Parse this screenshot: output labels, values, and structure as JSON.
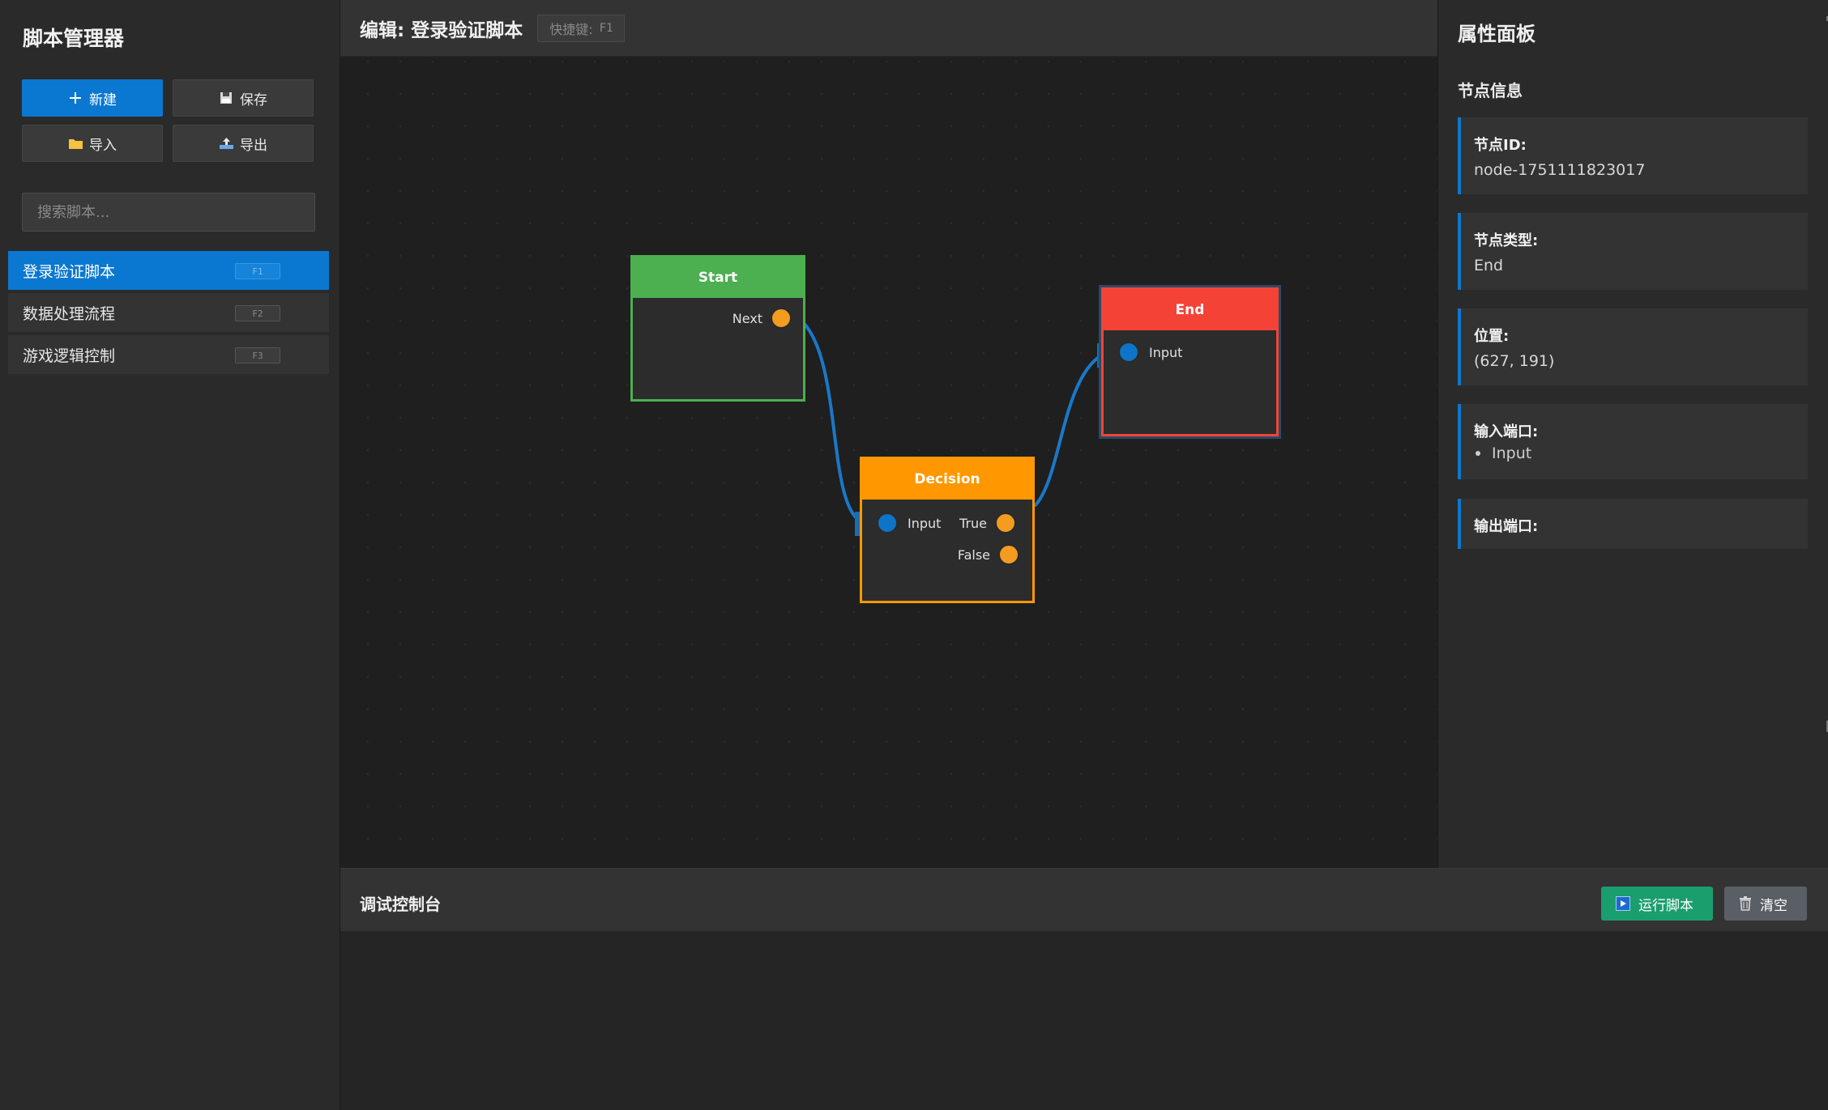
{
  "sidebar": {
    "title": "脚本管理器",
    "buttons": {
      "new": "新建",
      "save": "保存",
      "import": "导入",
      "export": "导出"
    },
    "search_placeholder": "搜索脚本...",
    "scripts": [
      {
        "name": "登录验证脚本",
        "shortcut": "F1",
        "active": true
      },
      {
        "name": "数据处理流程",
        "shortcut": "F2",
        "active": false
      },
      {
        "name": "游戏逻辑控制",
        "shortcut": "F3",
        "active": false
      }
    ]
  },
  "editor": {
    "title": "编辑: 登录验证脚本",
    "shortcut_label": "快捷键:",
    "shortcut_key": "F1"
  },
  "graph": {
    "nodes": {
      "start": {
        "title": "Start",
        "outputs": [
          "Next"
        ],
        "color": "#4caf50"
      },
      "decision": {
        "title": "Decision",
        "inputs": [
          "Input"
        ],
        "outputs": [
          "True",
          "False"
        ],
        "color": "#ff9800"
      },
      "end": {
        "title": "End",
        "inputs": [
          "Input"
        ],
        "color": "#f44336"
      }
    },
    "wire_color": "#1a78c8"
  },
  "properties": {
    "title": "属性面板",
    "section": "节点信息",
    "node_id_label": "节点ID:",
    "node_id": "node-1751111823017",
    "node_type_label": "节点类型:",
    "node_type": "End",
    "position_label": "位置:",
    "position": "(627, 191)",
    "inputs_label": "输入端口:",
    "inputs": [
      "Input"
    ],
    "outputs_label": "输出端口:"
  },
  "console": {
    "title": "调试控制台",
    "run": "运行脚本",
    "clear": "清空"
  }
}
